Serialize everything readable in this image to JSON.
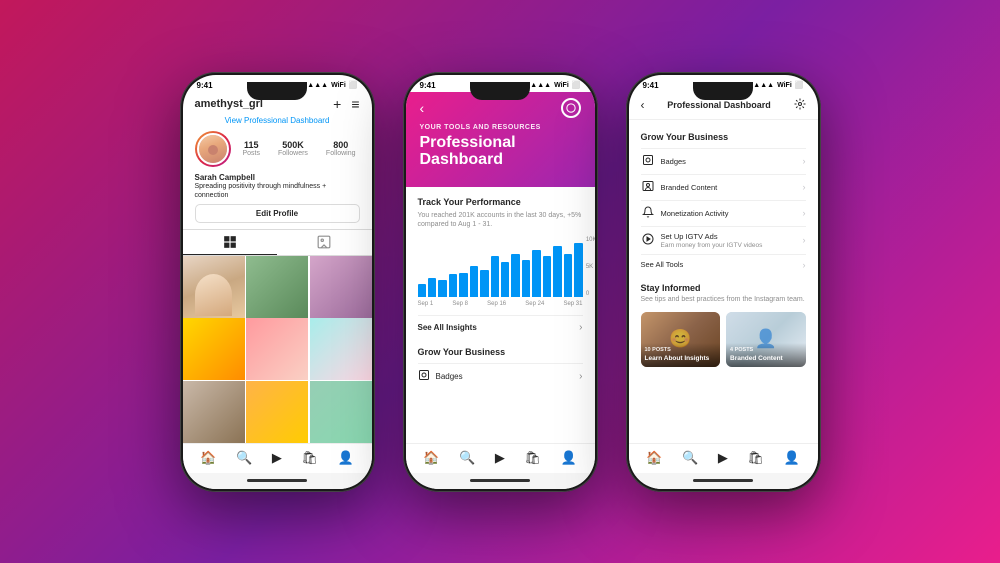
{
  "background": {
    "gradient_start": "#c2185b",
    "gradient_end": "#9c27b0"
  },
  "phone1": {
    "status_bar": {
      "time": "9:41",
      "signal": "●●●",
      "wifi": "WiFi",
      "battery": "100%"
    },
    "header": {
      "username": "amethyst_grl",
      "add_icon": "+",
      "menu_icon": "≡"
    },
    "view_dashboard": "View Professional Dashboard",
    "profile": {
      "stats": [
        {
          "number": "115",
          "label": "Posts"
        },
        {
          "number": "500K",
          "label": "Followers"
        },
        {
          "number": "800",
          "label": "Following"
        }
      ],
      "name": "Sarah Campbell",
      "bio": "Spreading positivity through mindfulness + connection",
      "edit_button": "Edit Profile"
    },
    "tabs": [
      {
        "label": "⊞",
        "active": true
      },
      {
        "label": "🎭",
        "active": false
      }
    ],
    "bottom_nav": [
      "🏠",
      "🔍",
      "➕",
      "🛍",
      "👤"
    ]
  },
  "phone2": {
    "status_bar": {
      "time": "9:41"
    },
    "header": {
      "back_icon": "‹",
      "subtitle": "Your Tools and Resources",
      "title_line1": "Professional",
      "title_line2": "Dashboard"
    },
    "track_performance": {
      "title": "Track Your Performance",
      "description": "You reached 201K accounts in the last 30 days, +5% compared to Aug 1 - 31.",
      "chart_bars": [
        20,
        30,
        25,
        40,
        35,
        50,
        45,
        65,
        55,
        70,
        60,
        75,
        65,
        80,
        70,
        85
      ],
      "chart_labels": [
        "Sep 1",
        "Sep 8",
        "Sep 16",
        "Sep 24",
        "Sep 31"
      ],
      "y_axis": [
        "10K",
        "5K",
        "0"
      ]
    },
    "see_all_insights": "See All Insights",
    "grow_business": {
      "title": "Grow Your Business",
      "items": [
        {
          "icon": "⊡",
          "label": "Badges"
        }
      ]
    },
    "bottom_nav": [
      "🏠",
      "🔍",
      "➕",
      "🛍",
      "👤"
    ]
  },
  "phone3": {
    "status_bar": {
      "time": "9:41"
    },
    "header": {
      "back_icon": "‹",
      "title": "Professional Dashboard",
      "settings_icon": "⟳"
    },
    "grow_business": {
      "heading": "Grow Your Business",
      "items": [
        {
          "icon": "⊡",
          "label": "Badges",
          "sub": ""
        },
        {
          "icon": "◫",
          "label": "Branded Content",
          "sub": ""
        },
        {
          "icon": "🔔",
          "label": "Monetization Activity",
          "sub": ""
        },
        {
          "icon": "▶",
          "label": "Set Up IGTV Ads",
          "sub": "Earn money from your IGTV videos"
        }
      ],
      "see_all": "See All Tools"
    },
    "stay_informed": {
      "heading": "Stay Informed",
      "description": "See tips and best practices from the Instagram team.",
      "cards": [
        {
          "badge": "10 Posts",
          "title": "Learn About Insights",
          "bg_class": "p3-card-bg1"
        },
        {
          "badge": "4 Posts",
          "title": "Branded Content",
          "bg_class": "p3-card-bg2"
        }
      ]
    },
    "bottom_nav": [
      "🏠",
      "🔍",
      "➕",
      "🛍",
      "👤"
    ]
  }
}
